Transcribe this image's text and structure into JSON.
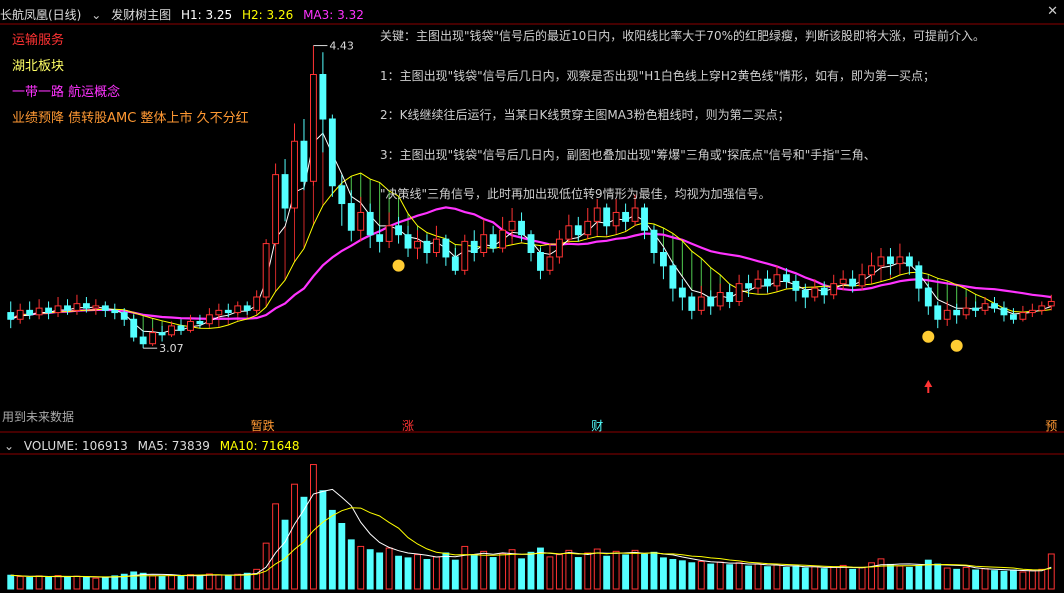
{
  "header": {
    "stock": "长航凤凰(日线)",
    "indicator": "发财树主图",
    "h1": "H1: 3.25",
    "h2": "H2: 3.26",
    "ma3": "MA3: 3.32"
  },
  "tags": [
    "运输服务",
    "湖北板块",
    "一带一路 航运概念",
    "业绩预降 债转股AMC 整体上市 久不分红"
  ],
  "tag_colors": [
    "#ff3333",
    "#ffff66",
    "#ff33ff",
    "#ff9933"
  ],
  "notes": [
    "关键：主图出现\"钱袋\"信号后的最近10日内，收阳线比率大于70%的红肥绿瘦，判断该股即将大涨，可提前介入。",
    "1：主图出现\"钱袋\"信号后几日内，观察是否出现\"H1白色线上穿H2黄色线\"情形，如有，即为第一买点；",
    "2：K线继续往后运行，当某日K线贯穿主图MA3粉色粗线时，则为第二买点；",
    "3：主图出现\"钱袋\"信号后几日内，副图也叠加出现\"筹爆\"三角或\"探底点\"信号和\"手指\"三角、",
    "\"决策线\"三角信号，此时再加出现低位转9情形为最佳，均视为加强信号。"
  ],
  "future_label": "用到未来数据",
  "event_markers": [
    "暂跌",
    "涨",
    "财",
    "预"
  ],
  "volume_header": {
    "volume": "VOLUME: 106913",
    "ma5": "MA5: 73839",
    "ma10": "MA10: 71648"
  },
  "colors": {
    "up": "#ff3333",
    "down": "#54ffff",
    "h1": "#ffffff",
    "h2": "#ffff00",
    "ma3": "#ff33ff",
    "ribbon": "#66ff66",
    "axis": "#8b0000"
  },
  "chart_data": {
    "type": "candlestick",
    "price_range": [
      2.9,
      4.5
    ],
    "annotations": [
      {
        "label": "4.43",
        "value": 4.43
      },
      {
        "label": "3.07",
        "value": 3.07
      }
    ],
    "candles": [
      [
        3.23,
        3.2,
        3.28,
        3.16
      ],
      [
        3.2,
        3.24,
        3.27,
        3.18
      ],
      [
        3.24,
        3.22,
        3.28,
        3.2
      ],
      [
        3.22,
        3.25,
        3.29,
        3.2
      ],
      [
        3.25,
        3.23,
        3.28,
        3.2
      ],
      [
        3.23,
        3.26,
        3.3,
        3.21
      ],
      [
        3.26,
        3.24,
        3.29,
        3.22
      ],
      [
        3.24,
        3.27,
        3.31,
        3.22
      ],
      [
        3.27,
        3.25,
        3.3,
        3.23
      ],
      [
        3.25,
        3.26,
        3.29,
        3.22
      ],
      [
        3.26,
        3.24,
        3.28,
        3.21
      ],
      [
        3.24,
        3.23,
        3.27,
        3.2
      ],
      [
        3.23,
        3.2,
        3.25,
        3.17
      ],
      [
        3.2,
        3.12,
        3.22,
        3.1
      ],
      [
        3.12,
        3.09,
        3.15,
        3.07
      ],
      [
        3.09,
        3.14,
        3.16,
        3.08
      ],
      [
        3.14,
        3.13,
        3.17,
        3.1
      ],
      [
        3.13,
        3.17,
        3.19,
        3.12
      ],
      [
        3.17,
        3.15,
        3.2,
        3.13
      ],
      [
        3.15,
        3.19,
        3.22,
        3.14
      ],
      [
        3.19,
        3.18,
        3.22,
        3.16
      ],
      [
        3.18,
        3.22,
        3.25,
        3.17
      ],
      [
        3.22,
        3.24,
        3.27,
        3.2
      ],
      [
        3.24,
        3.23,
        3.27,
        3.21
      ],
      [
        3.23,
        3.26,
        3.28,
        3.22
      ],
      [
        3.26,
        3.24,
        3.28,
        3.22
      ],
      [
        3.24,
        3.3,
        3.33,
        3.23
      ],
      [
        3.3,
        3.54,
        3.56,
        3.29
      ],
      [
        3.54,
        3.85,
        3.9,
        3.53
      ],
      [
        3.85,
        3.7,
        3.92,
        3.64
      ],
      [
        3.7,
        4.0,
        4.08,
        3.68
      ],
      [
        4.0,
        3.82,
        4.1,
        3.78
      ],
      [
        3.82,
        4.3,
        4.43,
        3.8
      ],
      [
        4.3,
        4.1,
        4.4,
        3.95
      ],
      [
        4.1,
        3.8,
        4.12,
        3.75
      ],
      [
        3.8,
        3.72,
        3.85,
        3.62
      ],
      [
        3.72,
        3.6,
        3.78,
        3.55
      ],
      [
        3.6,
        3.68,
        3.75,
        3.55
      ],
      [
        3.68,
        3.58,
        3.72,
        3.52
      ],
      [
        3.58,
        3.55,
        3.62,
        3.5
      ],
      [
        3.55,
        3.62,
        3.68,
        3.52
      ],
      [
        3.62,
        3.58,
        3.66,
        3.54
      ],
      [
        3.58,
        3.52,
        3.62,
        3.48
      ],
      [
        3.52,
        3.55,
        3.6,
        3.47
      ],
      [
        3.55,
        3.5,
        3.58,
        3.45
      ],
      [
        3.5,
        3.56,
        3.62,
        3.48
      ],
      [
        3.56,
        3.48,
        3.58,
        3.44
      ],
      [
        3.48,
        3.42,
        3.52,
        3.4
      ],
      [
        3.42,
        3.55,
        3.58,
        3.4
      ],
      [
        3.55,
        3.5,
        3.6,
        3.46
      ],
      [
        3.5,
        3.58,
        3.65,
        3.48
      ],
      [
        3.58,
        3.52,
        3.62,
        3.5
      ],
      [
        3.52,
        3.6,
        3.66,
        3.5
      ],
      [
        3.6,
        3.64,
        3.7,
        3.56
      ],
      [
        3.64,
        3.58,
        3.68,
        3.55
      ],
      [
        3.58,
        3.5,
        3.6,
        3.46
      ],
      [
        3.5,
        3.42,
        3.52,
        3.38
      ],
      [
        3.42,
        3.48,
        3.54,
        3.4
      ],
      [
        3.48,
        3.56,
        3.6,
        3.45
      ],
      [
        3.56,
        3.62,
        3.67,
        3.54
      ],
      [
        3.62,
        3.58,
        3.66,
        3.55
      ],
      [
        3.58,
        3.64,
        3.7,
        3.56
      ],
      [
        3.64,
        3.7,
        3.74,
        3.6
      ],
      [
        3.7,
        3.62,
        3.72,
        3.58
      ],
      [
        3.62,
        3.68,
        3.74,
        3.6
      ],
      [
        3.68,
        3.64,
        3.72,
        3.6
      ],
      [
        3.64,
        3.7,
        3.76,
        3.62
      ],
      [
        3.7,
        3.6,
        3.72,
        3.56
      ],
      [
        3.6,
        3.5,
        3.62,
        3.45
      ],
      [
        3.5,
        3.44,
        3.52,
        3.38
      ],
      [
        3.44,
        3.34,
        3.46,
        3.28
      ],
      [
        3.34,
        3.3,
        3.38,
        3.24
      ],
      [
        3.3,
        3.24,
        3.32,
        3.2
      ],
      [
        3.24,
        3.3,
        3.35,
        3.22
      ],
      [
        3.3,
        3.26,
        3.33,
        3.22
      ],
      [
        3.26,
        3.32,
        3.36,
        3.24
      ],
      [
        3.32,
        3.28,
        3.36,
        3.25
      ],
      [
        3.28,
        3.36,
        3.4,
        3.26
      ],
      [
        3.36,
        3.34,
        3.4,
        3.3
      ],
      [
        3.34,
        3.38,
        3.42,
        3.32
      ],
      [
        3.38,
        3.35,
        3.42,
        3.32
      ],
      [
        3.35,
        3.4,
        3.44,
        3.33
      ],
      [
        3.4,
        3.37,
        3.43,
        3.34
      ],
      [
        3.37,
        3.33,
        3.4,
        3.28
      ],
      [
        3.33,
        3.3,
        3.36,
        3.25
      ],
      [
        3.3,
        3.34,
        3.38,
        3.28
      ],
      [
        3.34,
        3.31,
        3.37,
        3.27
      ],
      [
        3.31,
        3.36,
        3.4,
        3.29
      ],
      [
        3.36,
        3.38,
        3.42,
        3.33
      ],
      [
        3.38,
        3.35,
        3.42,
        3.32
      ],
      [
        3.35,
        3.4,
        3.45,
        3.33
      ],
      [
        3.4,
        3.44,
        3.5,
        3.38
      ],
      [
        3.44,
        3.48,
        3.52,
        3.42
      ],
      [
        3.48,
        3.45,
        3.52,
        3.4
      ],
      [
        3.45,
        3.48,
        3.54,
        3.42
      ],
      [
        3.48,
        3.44,
        3.5,
        3.4
      ],
      [
        3.44,
        3.34,
        3.46,
        3.28
      ],
      [
        3.34,
        3.26,
        3.36,
        3.22
      ],
      [
        3.26,
        3.2,
        3.28,
        3.16
      ],
      [
        3.2,
        3.24,
        3.28,
        3.17
      ],
      [
        3.24,
        3.22,
        3.27,
        3.18
      ],
      [
        3.22,
        3.25,
        3.3,
        3.2
      ],
      [
        3.25,
        3.24,
        3.28,
        3.21
      ],
      [
        3.24,
        3.27,
        3.3,
        3.22
      ],
      [
        3.27,
        3.25,
        3.3,
        3.23
      ],
      [
        3.25,
        3.22,
        3.28,
        3.19
      ],
      [
        3.22,
        3.2,
        3.25,
        3.18
      ],
      [
        3.2,
        3.23,
        3.26,
        3.19
      ],
      [
        3.23,
        3.24,
        3.27,
        3.21
      ],
      [
        3.24,
        3.26,
        3.28,
        3.22
      ],
      [
        3.26,
        3.28,
        3.31,
        3.24
      ]
    ],
    "volume_range": [
      0,
      400000
    ],
    "volumes": [
      42000,
      38000,
      35000,
      40000,
      36000,
      41000,
      37000,
      39000,
      35000,
      33000,
      36000,
      40000,
      45000,
      52000,
      48000,
      40000,
      38000,
      42000,
      39000,
      44000,
      41000,
      46000,
      43000,
      40000,
      45000,
      48000,
      60000,
      140000,
      260000,
      210000,
      320000,
      280000,
      380000,
      300000,
      240000,
      200000,
      150000,
      130000,
      120000,
      110000,
      125000,
      100000,
      95000,
      105000,
      90000,
      98000,
      110000,
      88000,
      130000,
      102000,
      115000,
      96000,
      108000,
      120000,
      92000,
      112000,
      125000,
      98000,
      105000,
      118000,
      96000,
      110000,
      122000,
      100000,
      115000,
      104000,
      118000,
      106000,
      112000,
      95000,
      90000,
      86000,
      80000,
      84000,
      76000,
      82000,
      74000,
      80000,
      70000,
      76000,
      68000,
      73000,
      66000,
      70000,
      64000,
      68000,
      62000,
      66000,
      72000,
      60000,
      65000,
      80000,
      92000,
      75000,
      70000,
      66000,
      72000,
      88000,
      76000,
      64000,
      60000,
      66000,
      58000,
      62000,
      56000,
      54000,
      58000,
      52000,
      56000,
      60000,
      106913
    ],
    "series": [
      {
        "name": "H1"
      },
      {
        "name": "H2"
      },
      {
        "name": "MA3"
      },
      {
        "name": "MA5"
      },
      {
        "name": "MA10"
      }
    ]
  }
}
